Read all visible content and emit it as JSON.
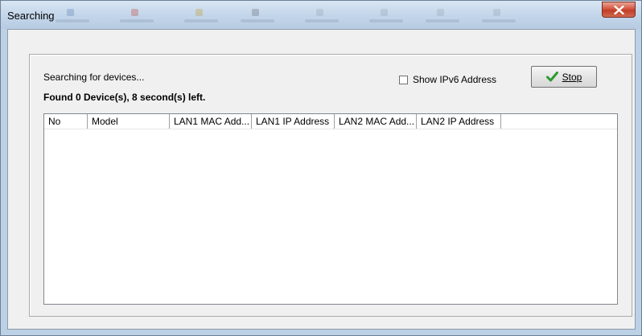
{
  "window": {
    "title": "Searching",
    "close_icon": "close-x-icon"
  },
  "search": {
    "status_text": "Searching for devices...",
    "found_text": "Found 0 Device(s), 8 second(s) left.",
    "show_ipv6_label": "Show IPv6 Address",
    "show_ipv6_checked": false,
    "stop_label": "Stop",
    "stop_icon": "checkmark-icon"
  },
  "table": {
    "columns": [
      "No",
      "Model",
      "LAN1 MAC Add...",
      "LAN1 IP Address",
      "LAN2 MAC Add...",
      "LAN2 IP Address"
    ],
    "rows": []
  },
  "colors": {
    "checkmark": "#2e9a2e",
    "close_button": "#c94a35"
  }
}
